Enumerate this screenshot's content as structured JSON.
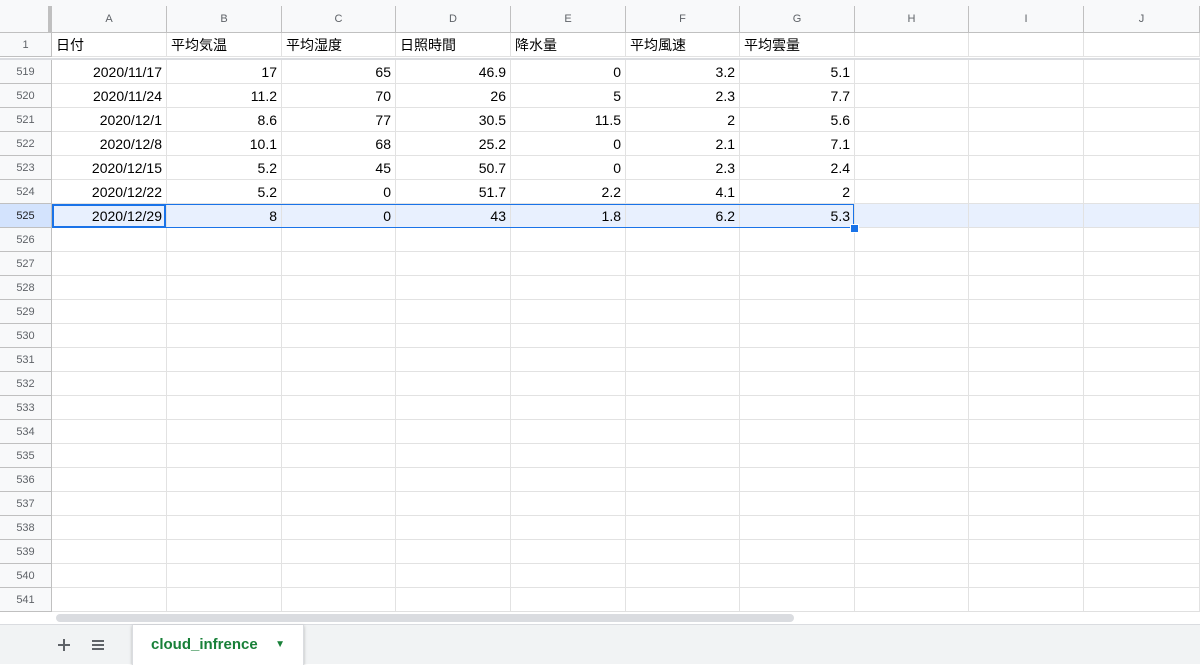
{
  "columns": [
    "A",
    "B",
    "C",
    "D",
    "E",
    "F",
    "G",
    "H",
    "I",
    "J"
  ],
  "header_row": {
    "row": "1",
    "cells": [
      "日付",
      "平均気温",
      "平均湿度",
      "日照時間",
      "降水量",
      "平均風速",
      "平均雲量",
      "",
      "",
      ""
    ]
  },
  "rows": [
    {
      "row": "519",
      "cells": [
        "2020/11/17",
        "17",
        "65",
        "46.9",
        "0",
        "3.2",
        "5.1",
        "",
        "",
        ""
      ]
    },
    {
      "row": "520",
      "cells": [
        "2020/11/24",
        "11.2",
        "70",
        "26",
        "5",
        "2.3",
        "7.7",
        "",
        "",
        ""
      ]
    },
    {
      "row": "521",
      "cells": [
        "2020/12/1",
        "8.6",
        "77",
        "30.5",
        "11.5",
        "2",
        "5.6",
        "",
        "",
        ""
      ]
    },
    {
      "row": "522",
      "cells": [
        "2020/12/8",
        "10.1",
        "68",
        "25.2",
        "0",
        "2.1",
        "7.1",
        "",
        "",
        ""
      ]
    },
    {
      "row": "523",
      "cells": [
        "2020/12/15",
        "5.2",
        "45",
        "50.7",
        "0",
        "2.3",
        "2.4",
        "",
        "",
        ""
      ]
    },
    {
      "row": "524",
      "cells": [
        "2020/12/22",
        "5.2",
        "0",
        "51.7",
        "2.2",
        "4.1",
        "2",
        "",
        "",
        ""
      ]
    },
    {
      "row": "525",
      "cells": [
        "2020/12/29",
        "8",
        "0",
        "43",
        "1.8",
        "6.2",
        "5.3",
        "",
        "",
        ""
      ]
    },
    {
      "row": "526",
      "cells": [
        "",
        "",
        "",
        "",
        "",
        "",
        "",
        "",
        "",
        ""
      ]
    },
    {
      "row": "527",
      "cells": [
        "",
        "",
        "",
        "",
        "",
        "",
        "",
        "",
        "",
        ""
      ]
    },
    {
      "row": "528",
      "cells": [
        "",
        "",
        "",
        "",
        "",
        "",
        "",
        "",
        "",
        ""
      ]
    },
    {
      "row": "529",
      "cells": [
        "",
        "",
        "",
        "",
        "",
        "",
        "",
        "",
        "",
        ""
      ]
    },
    {
      "row": "530",
      "cells": [
        "",
        "",
        "",
        "",
        "",
        "",
        "",
        "",
        "",
        ""
      ]
    },
    {
      "row": "531",
      "cells": [
        "",
        "",
        "",
        "",
        "",
        "",
        "",
        "",
        "",
        ""
      ]
    },
    {
      "row": "532",
      "cells": [
        "",
        "",
        "",
        "",
        "",
        "",
        "",
        "",
        "",
        ""
      ]
    },
    {
      "row": "533",
      "cells": [
        "",
        "",
        "",
        "",
        "",
        "",
        "",
        "",
        "",
        ""
      ]
    },
    {
      "row": "534",
      "cells": [
        "",
        "",
        "",
        "",
        "",
        "",
        "",
        "",
        "",
        ""
      ]
    },
    {
      "row": "535",
      "cells": [
        "",
        "",
        "",
        "",
        "",
        "",
        "",
        "",
        "",
        ""
      ]
    },
    {
      "row": "536",
      "cells": [
        "",
        "",
        "",
        "",
        "",
        "",
        "",
        "",
        "",
        ""
      ]
    },
    {
      "row": "537",
      "cells": [
        "",
        "",
        "",
        "",
        "",
        "",
        "",
        "",
        "",
        ""
      ]
    },
    {
      "row": "538",
      "cells": [
        "",
        "",
        "",
        "",
        "",
        "",
        "",
        "",
        "",
        ""
      ]
    },
    {
      "row": "539",
      "cells": [
        "",
        "",
        "",
        "",
        "",
        "",
        "",
        "",
        "",
        ""
      ]
    },
    {
      "row": "540",
      "cells": [
        "",
        "",
        "",
        "",
        "",
        "",
        "",
        "",
        "",
        ""
      ]
    },
    {
      "row": "541",
      "cells": [
        "",
        "",
        "",
        "",
        "",
        "",
        "",
        "",
        "",
        ""
      ]
    }
  ],
  "selected_row": "525",
  "tabs": {
    "add_icon": "plus-icon",
    "all_sheets_icon": "list-icon",
    "sheet_name": "cloud_infrence",
    "dropdown_icon": "caret-down-icon"
  },
  "colors": {
    "accent": "#1a73e8",
    "sheet_tab_text": "#188038",
    "selection_fill": "#e8f0fe"
  }
}
